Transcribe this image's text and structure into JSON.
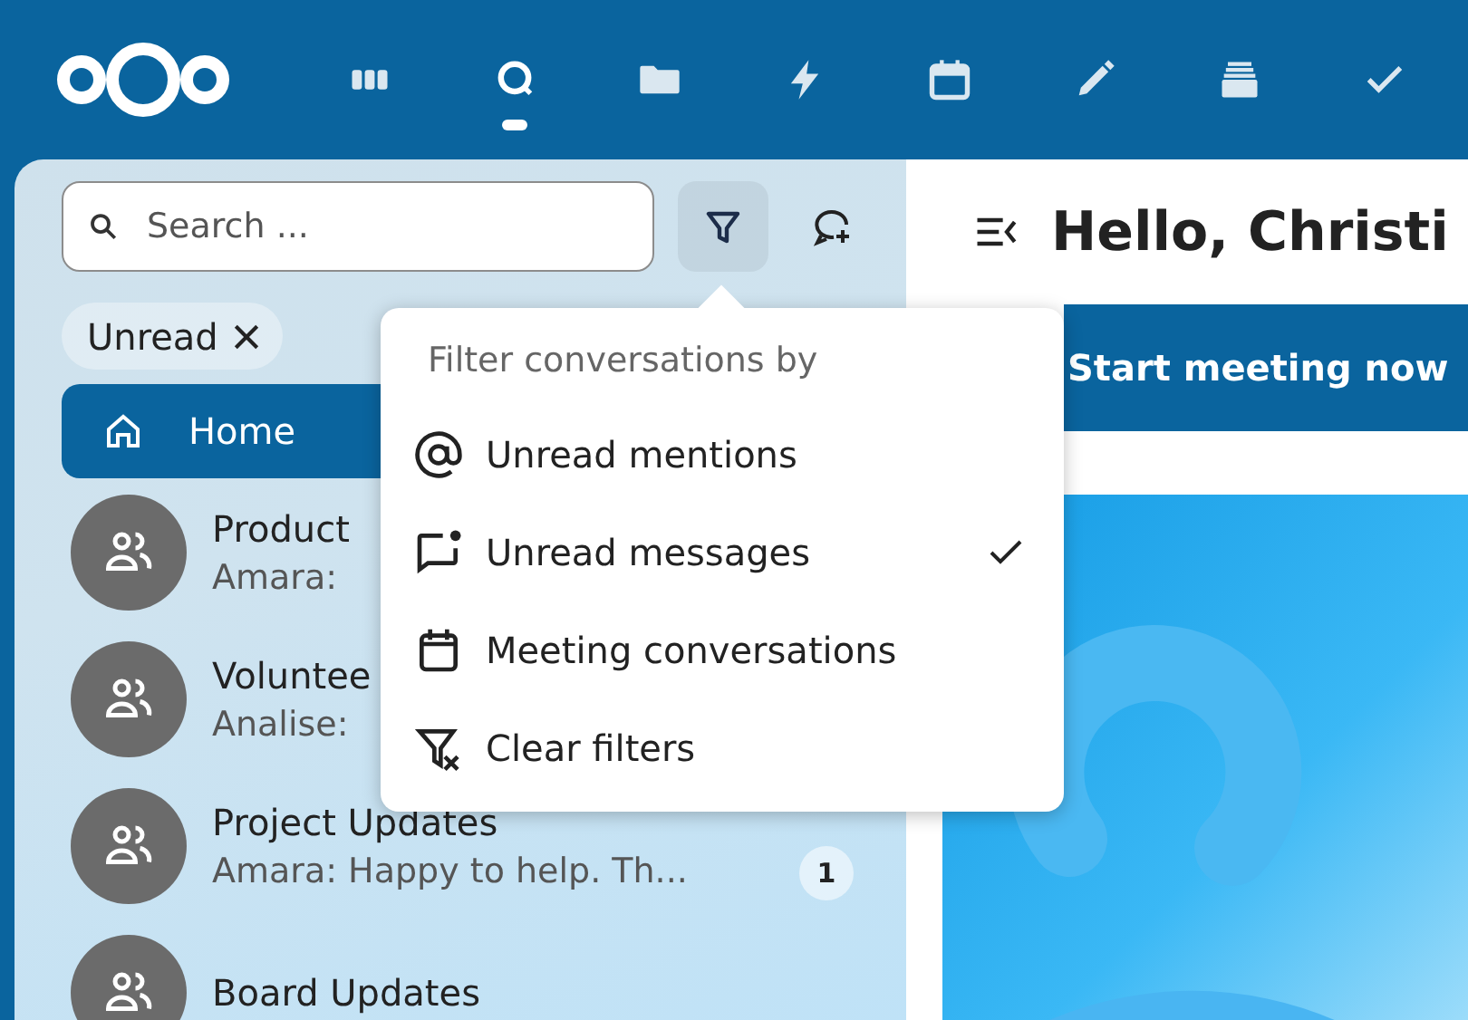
{
  "top_bar": {
    "apps": [
      {
        "selected": false
      },
      {
        "selected": true
      },
      {
        "selected": false
      },
      {
        "selected": false
      },
      {
        "selected": false
      },
      {
        "selected": false
      },
      {
        "selected": false
      },
      {
        "selected": false
      }
    ]
  },
  "sidebar": {
    "search": {
      "placeholder": "Search ..."
    },
    "filter_button": {
      "active": true
    },
    "filter_chips": [
      {
        "label": "Unread"
      }
    ],
    "nav": [
      {
        "label": "Home",
        "selected": true
      }
    ],
    "conversations": [
      {
        "name": "Product",
        "preview": "Amara:"
      },
      {
        "name": "Voluntee",
        "preview": "Analise:"
      },
      {
        "name": "Project Updates",
        "preview": "Amara: Happy to help. Th...",
        "unread": "1"
      },
      {
        "name": "Board Updates"
      }
    ]
  },
  "filter_menu": {
    "title": "Filter conversations by",
    "items": [
      {
        "kind": "mentions",
        "label": "Unread mentions",
        "checked": false
      },
      {
        "kind": "unread",
        "label": "Unread messages",
        "checked": true
      },
      {
        "kind": "meetings",
        "label": "Meeting conversations",
        "checked": false
      },
      {
        "kind": "clear",
        "label": "Clear filters",
        "checked": false
      }
    ]
  },
  "main": {
    "heading": "Hello, Christi",
    "primary_button": "Start meeting now"
  }
}
